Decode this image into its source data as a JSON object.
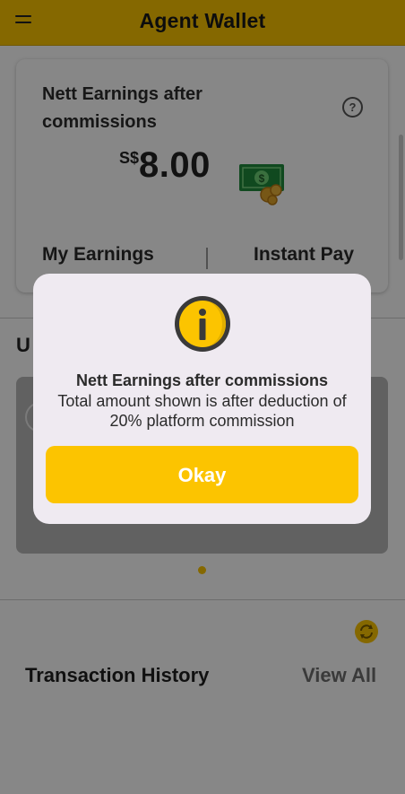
{
  "header": {
    "title": "Agent Wallet",
    "menu_icon": "hamburger-menu-icon"
  },
  "earnings_card": {
    "title": "Nett Earnings after commissions",
    "help_icon": "question-circle-icon",
    "currency": "S$",
    "amount": "8.00",
    "amount_icon": "money-bill-coins-icon",
    "tabs": [
      "My Earnings",
      "Instant Pay"
    ]
  },
  "section": {
    "title_fragment": "U"
  },
  "transactions": {
    "refresh_icon": "refresh-icon",
    "title": "Transaction History",
    "view_all_label": "View All"
  },
  "dialog": {
    "icon": "info-icon",
    "title": "Nett Earnings after commissions",
    "message": "Total amount shown is after deduction of 20% platform commission",
    "button_label": "Okay"
  },
  "colors": {
    "accent": "#fcc400",
    "money_green": "#1f8a3c",
    "coin_gold": "#e0a42a",
    "scrim": "rgba(0,0,0,0.47)",
    "dialog_bg": "#efeaf1"
  }
}
